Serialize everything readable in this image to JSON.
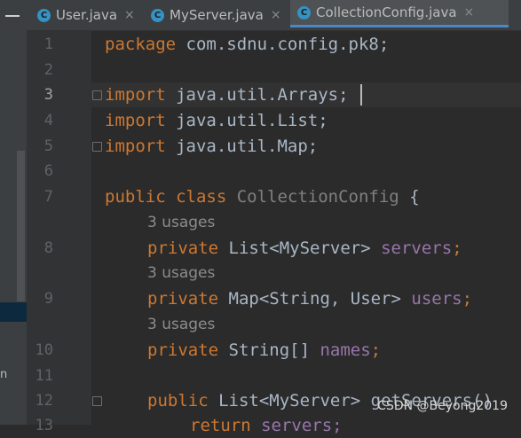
{
  "tabs": [
    {
      "label": "User.java",
      "icon": "c-class-icon",
      "active": false
    },
    {
      "label": "MyServer.java",
      "icon": "c-class-icon",
      "active": false
    },
    {
      "label": "CollectionConfig.java",
      "icon": "c-class-icon",
      "active": true
    }
  ],
  "tab_close_glyph": "×",
  "class_icon_letter": "C",
  "left_panel_fragment": "n",
  "line_numbers": [
    "1",
    "2",
    "3",
    "4",
    "5",
    "6",
    "7",
    "8",
    "9",
    "10",
    "11",
    "12",
    "13"
  ],
  "current_line": "3",
  "code": {
    "l1_kw": "package",
    "l1_rest": " com.sdnu.config.pk8;",
    "l3_kw": "import",
    "l3_rest": " java.util.Arrays;",
    "l4_kw": "import",
    "l4_rest": " java.util.List;",
    "l5_kw": "import",
    "l5_rest": " java.util.Map;",
    "l7_kw": "public class ",
    "l7_cls": "CollectionConfig",
    "l7_rest": " {",
    "hint1": "3 usages",
    "l8_kw": "private ",
    "l8_type": "List<MyServer> ",
    "l8_field": "servers",
    "l8_end": ";",
    "hint2": "3 usages",
    "l9_kw": "private ",
    "l9_type": "Map<String, User> ",
    "l9_field": "users",
    "l9_end": ";",
    "hint3": "3 usages",
    "l10_kw": "private ",
    "l10_type": "String[] ",
    "l10_field": "names",
    "l10_end": ";",
    "l12_kw": "public ",
    "l12_type": "List<MyServer> ",
    "l12_method": "getServers()",
    "l13_kw": "return ",
    "l13_field": "servers;"
  },
  "watermark": "CSDN @Beyong2019",
  "colors": {
    "keyword": "#cc7832",
    "plain": "#a9b7c6",
    "field": "#9876aa",
    "unused_class": "#808080",
    "background": "#2b2b2b",
    "tab_accent": "#4a88c7"
  }
}
